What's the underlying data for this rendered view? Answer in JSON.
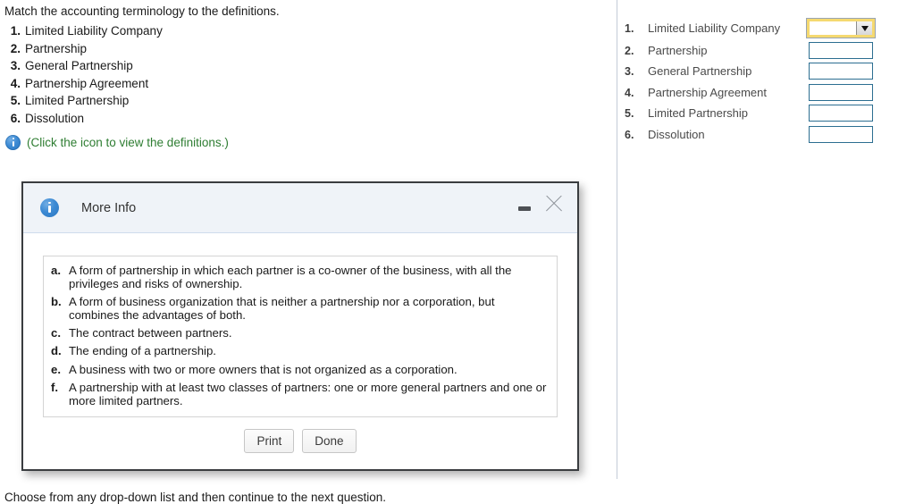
{
  "question": {
    "prompt": "Match the accounting terminology to the definitions.",
    "terms": [
      {
        "num": "1.",
        "label": "Limited Liability Company"
      },
      {
        "num": "2.",
        "label": "Partnership"
      },
      {
        "num": "3.",
        "label": "General Partnership"
      },
      {
        "num": "4.",
        "label": "Partnership Agreement"
      },
      {
        "num": "5.",
        "label": "Limited Partnership"
      },
      {
        "num": "6.",
        "label": "Dissolution"
      }
    ],
    "definitions_hint": "(Click the icon to view the definitions.)",
    "hint_icon": "info-icon",
    "bottom_clipped_text": "Choose from any drop-down list and then continue to the next question."
  },
  "answers": {
    "rows": [
      {
        "num": "1.",
        "label": "Limited Liability Company",
        "value": "",
        "active": true
      },
      {
        "num": "2.",
        "label": "Partnership",
        "value": "",
        "active": false
      },
      {
        "num": "3.",
        "label": "General Partnership",
        "value": "",
        "active": false
      },
      {
        "num": "4.",
        "label": "Partnership Agreement",
        "value": "",
        "active": false
      },
      {
        "num": "5.",
        "label": "Limited Partnership",
        "value": "",
        "active": false
      },
      {
        "num": "6.",
        "label": "Dissolution",
        "value": "",
        "active": false
      }
    ],
    "dropdown_arrow_icon": "chevron-down-icon"
  },
  "modal": {
    "title": "More Info",
    "title_icon": "info-icon",
    "minimize_icon": "minimize-icon",
    "close_icon": "close-icon",
    "definitions": [
      {
        "letter": "a.",
        "text": "A form of partnership in which each partner is a co-owner of the business, with all the privileges and risks of ownership."
      },
      {
        "letter": "b.",
        "text": "A form of business organization that is neither a partnership nor a corporation, but combines the advantages of both."
      },
      {
        "letter": "c.",
        "text": "The contract between partners."
      },
      {
        "letter": "d.",
        "text": "The ending of a partnership."
      },
      {
        "letter": "e.",
        "text": "A business with two or more owners that is not organized as a corporation."
      },
      {
        "letter": "f.",
        "text": "A partnership with at least two classes of partners: one or more general partners and one or more limited partners."
      }
    ],
    "print_label": "Print",
    "done_label": "Done"
  },
  "colors": {
    "hint_green": "#2e7d32",
    "field_border": "#2c6e91",
    "active_highlight": "#f5d970",
    "modal_header_bg": "#eff3f8",
    "info_blue": "#3c8ad4"
  }
}
